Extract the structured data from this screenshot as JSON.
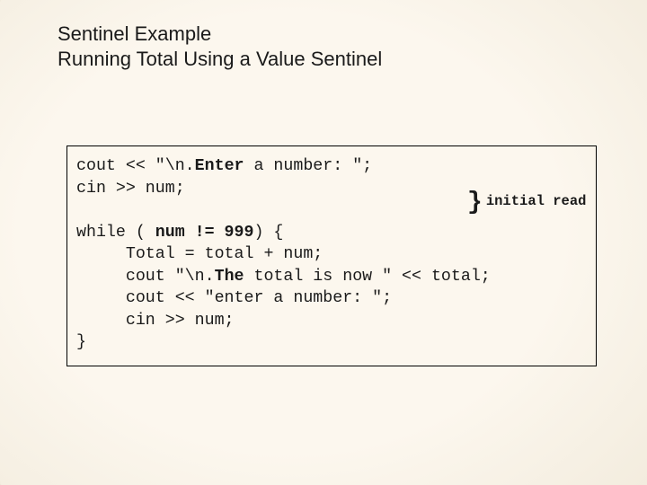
{
  "title": {
    "line1": "Sentinel Example",
    "line2": "Running Total Using a Value Sentinel"
  },
  "code": {
    "l1a": "cout << \"\\n.",
    "l1b": " a number: \";",
    "l1kw": "Enter",
    "l2": "cin >> num;",
    "l3a": "while ( ",
    "l3kw": "num != 999",
    "l3b": ") {",
    "l4": "     Total = total + num;",
    "l5a": "     cout \"\\n.",
    "l5kw": "The",
    "l5b": " total is now \" << total;",
    "l6": "     cout << \"enter a number: \";",
    "l7": "     cin >> num;",
    "l8": "}"
  },
  "annotation": {
    "label": "initial read"
  }
}
